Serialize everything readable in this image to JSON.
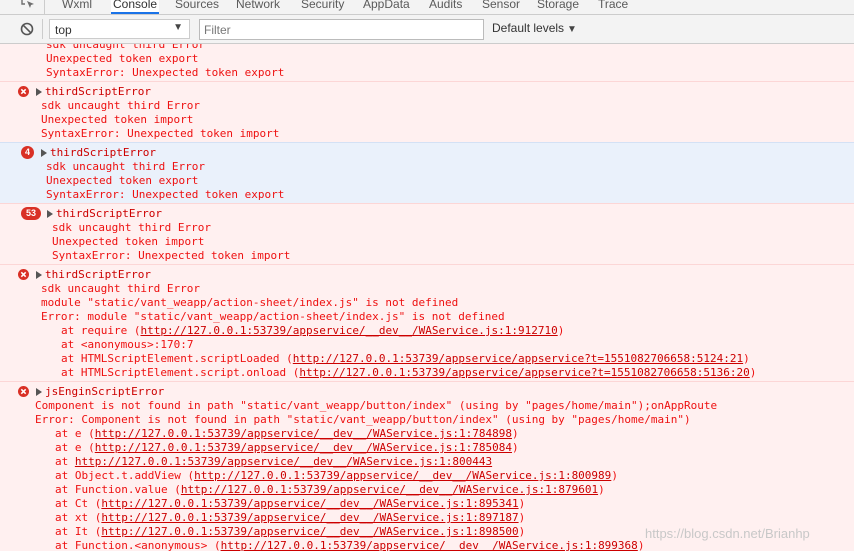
{
  "tabs": [
    "Wxml",
    "Console",
    "Sources",
    "Network",
    "Security",
    "AppData",
    "Audits",
    "Sensor",
    "Storage",
    "Trace"
  ],
  "active_tab": "Console",
  "toolbar": {
    "context": "top",
    "filter_placeholder": "Filter",
    "levels": "Default levels"
  },
  "messages": [
    {
      "title": "",
      "badge": "",
      "lines": [
        "sdk uncaught third Error",
        "Unexpected token export",
        "SyntaxError: Unexpected token export"
      ]
    },
    {
      "title": "thirdScriptError",
      "badge": "",
      "lines": [
        "sdk uncaught third Error",
        "Unexpected token import",
        "SyntaxError: Unexpected token import"
      ]
    },
    {
      "title": "thirdScriptError",
      "badge": "4",
      "lines": [
        "sdk uncaught third Error",
        "Unexpected token export",
        "SyntaxError: Unexpected token export"
      ]
    },
    {
      "title": "thirdScriptError",
      "badge": "53",
      "lines": [
        "sdk uncaught third Error",
        "Unexpected token import",
        "SyntaxError: Unexpected token import"
      ]
    },
    {
      "title": "thirdScriptError",
      "badge": "",
      "lines": [
        "sdk uncaught third Error",
        "module \"static/vant_weapp/action-sheet/index.js\" is not defined",
        "Error: module \"static/vant_weapp/action-sheet/index.js\" is not defined"
      ],
      "stack": [
        {
          "prefix": "at require (",
          "link": "http://127.0.0.1:53739/appservice/__dev__/WAService.js:1:912710",
          "suffix": ")"
        },
        {
          "prefix": "at <anonymous>:170:7",
          "link": "",
          "suffix": ""
        },
        {
          "prefix": "at HTMLScriptElement.scriptLoaded (",
          "link": "http://127.0.0.1:53739/appservice/appservice?t=1551082706658:5124:21",
          "suffix": ")"
        },
        {
          "prefix": "at HTMLScriptElement.script.onload (",
          "link": "http://127.0.0.1:53739/appservice/appservice?t=1551082706658:5136:20",
          "suffix": ")"
        }
      ]
    },
    {
      "title": "jsEnginScriptError",
      "badge": "",
      "lines": [
        "Component is not found in path \"static/vant_weapp/button/index\" (using by \"pages/home/main\");onAppRoute",
        "Error: Component is not found in path \"static/vant_weapp/button/index\" (using by \"pages/home/main\")"
      ],
      "stack": [
        {
          "prefix": "at e (",
          "link": "http://127.0.0.1:53739/appservice/__dev__/WAService.js:1:784898",
          "suffix": ")"
        },
        {
          "prefix": "at e (",
          "link": "http://127.0.0.1:53739/appservice/__dev__/WAService.js:1:785084",
          "suffix": ")"
        },
        {
          "prefix": "at ",
          "link": "http://127.0.0.1:53739/appservice/__dev__/WAService.js:1:800443",
          "suffix": ""
        },
        {
          "prefix": "at Object.t.addView (",
          "link": "http://127.0.0.1:53739/appservice/__dev__/WAService.js:1:800989",
          "suffix": ")"
        },
        {
          "prefix": "at Function.value (",
          "link": "http://127.0.0.1:53739/appservice/__dev__/WAService.js:1:879601",
          "suffix": ")"
        },
        {
          "prefix": "at Ct (",
          "link": "http://127.0.0.1:53739/appservice/__dev__/WAService.js:1:895341",
          "suffix": ")"
        },
        {
          "prefix": "at xt (",
          "link": "http://127.0.0.1:53739/appservice/__dev__/WAService.js:1:897187",
          "suffix": ")"
        },
        {
          "prefix": "at It (",
          "link": "http://127.0.0.1:53739/appservice/__dev__/WAService.js:1:898500",
          "suffix": ")"
        },
        {
          "prefix": "at Function.<anonymous> (",
          "link": "http://127.0.0.1:53739/appservice/__dev__/WAService.js:1:899368",
          "suffix": ")"
        }
      ]
    }
  ],
  "watermark": "https://blog.csdn.net/Brianhp",
  "icons": [
    "inspect-icon",
    "clear-console-icon",
    "error-icon",
    "expand-triangle-icon",
    "dropdown-arrow-icon"
  ],
  "colors": {
    "error_text": "#ee1111",
    "error_bg": "#fff0f0",
    "badge": "#d93025",
    "selected_bg": "#eaf1fb"
  }
}
